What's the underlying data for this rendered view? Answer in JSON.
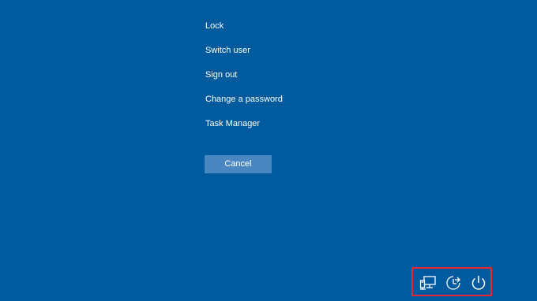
{
  "menu": {
    "items": [
      {
        "label": "Lock"
      },
      {
        "label": "Switch user"
      },
      {
        "label": "Sign out"
      },
      {
        "label": "Change a password"
      },
      {
        "label": "Task Manager"
      }
    ]
  },
  "cancel": {
    "label": "Cancel"
  },
  "tray": {
    "icons": [
      "network-icon",
      "ease-of-access-icon",
      "power-icon"
    ]
  },
  "colors": {
    "background": "#005a9e",
    "button": "#4a87c2",
    "highlight_border": "#e3262f"
  }
}
